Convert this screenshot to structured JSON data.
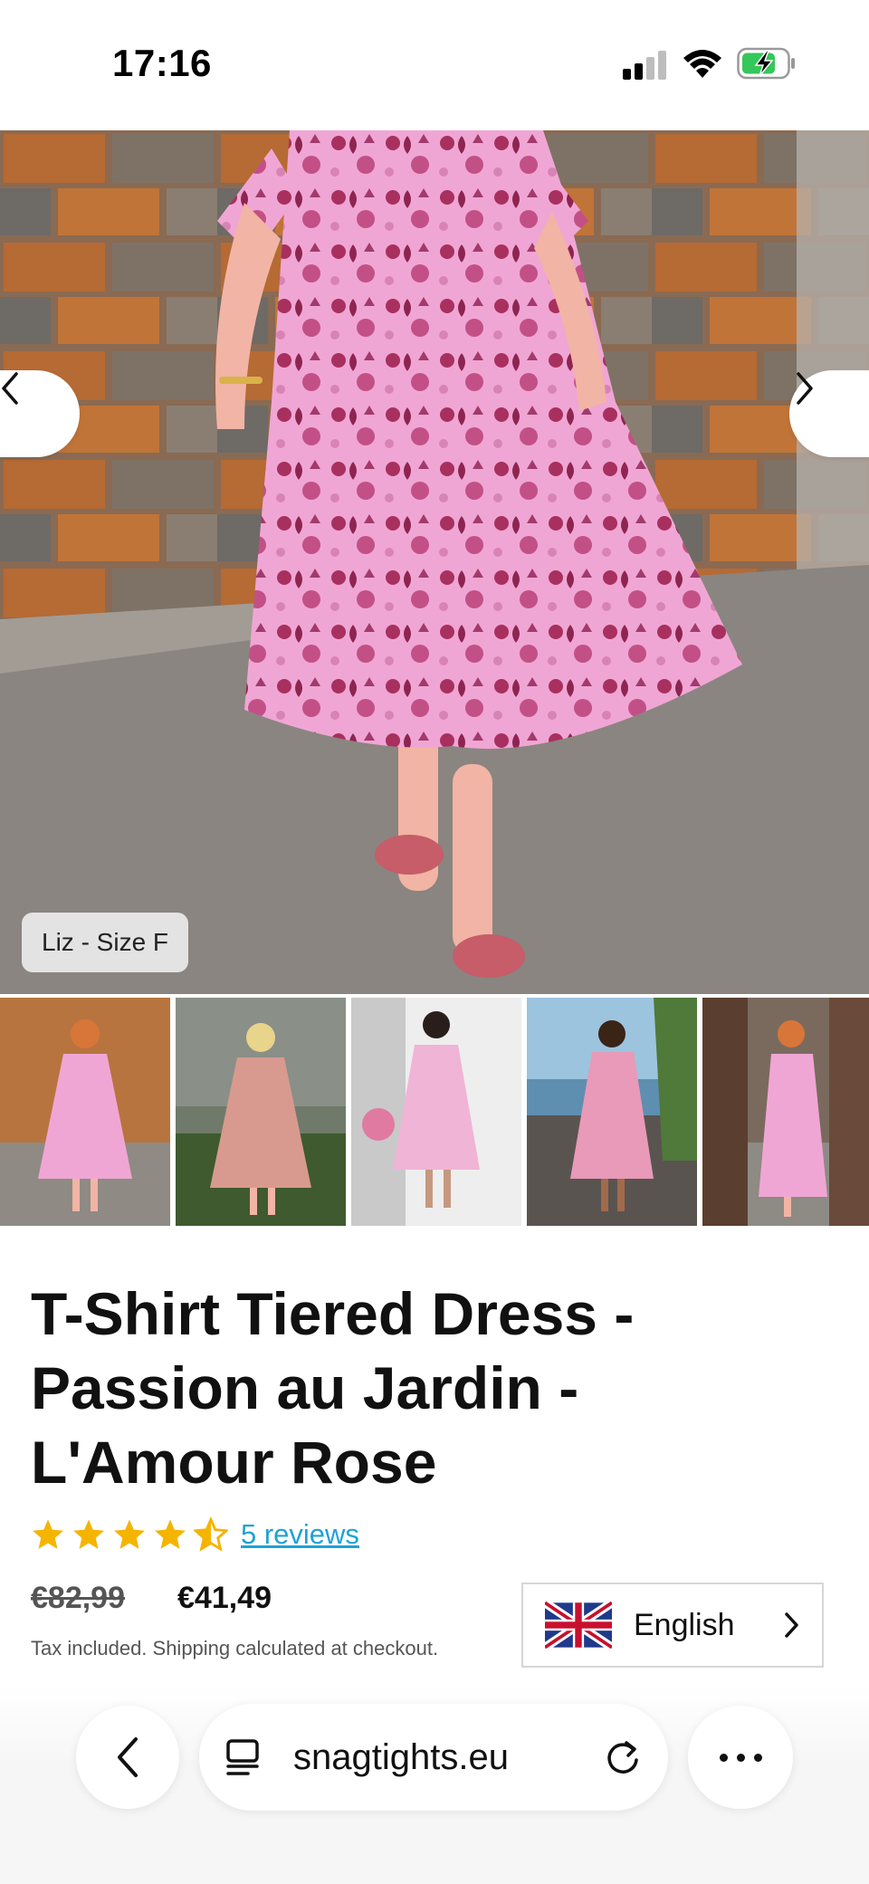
{
  "status_bar": {
    "time": "17:16",
    "icons": [
      "cellular-signal-icon",
      "wifi-icon",
      "battery-charging-icon"
    ],
    "battery_color": "#34c759"
  },
  "gallery": {
    "main_image_caption": "Liz - Size F",
    "prev_icon": "chevron-left-icon",
    "next_icon": "chevron-right-icon",
    "thumbnail_count": 5,
    "active_thumbnail": 1,
    "active_color": "#27a8e0"
  },
  "product": {
    "title": "T-Shirt Tiered Dress - Passion au Jardin - L'Amour Rose",
    "rating": 4.5,
    "rating_max": 5,
    "star_color": "#f5b400",
    "reviews_link": "5 reviews",
    "price_original": "€82,99",
    "price_sale": "€41,49",
    "tax_note": "Tax included. Shipping calculated at checkout."
  },
  "language_selector": {
    "flag": "uk-flag-icon",
    "label": "English",
    "chevron": "chevron-right-icon"
  },
  "browser": {
    "back_icon": "chevron-left-icon",
    "tabs_icon": "page-menu-icon",
    "url": "snagtights.eu",
    "reload_icon": "reload-icon",
    "more_icon": "more-dots-icon"
  }
}
